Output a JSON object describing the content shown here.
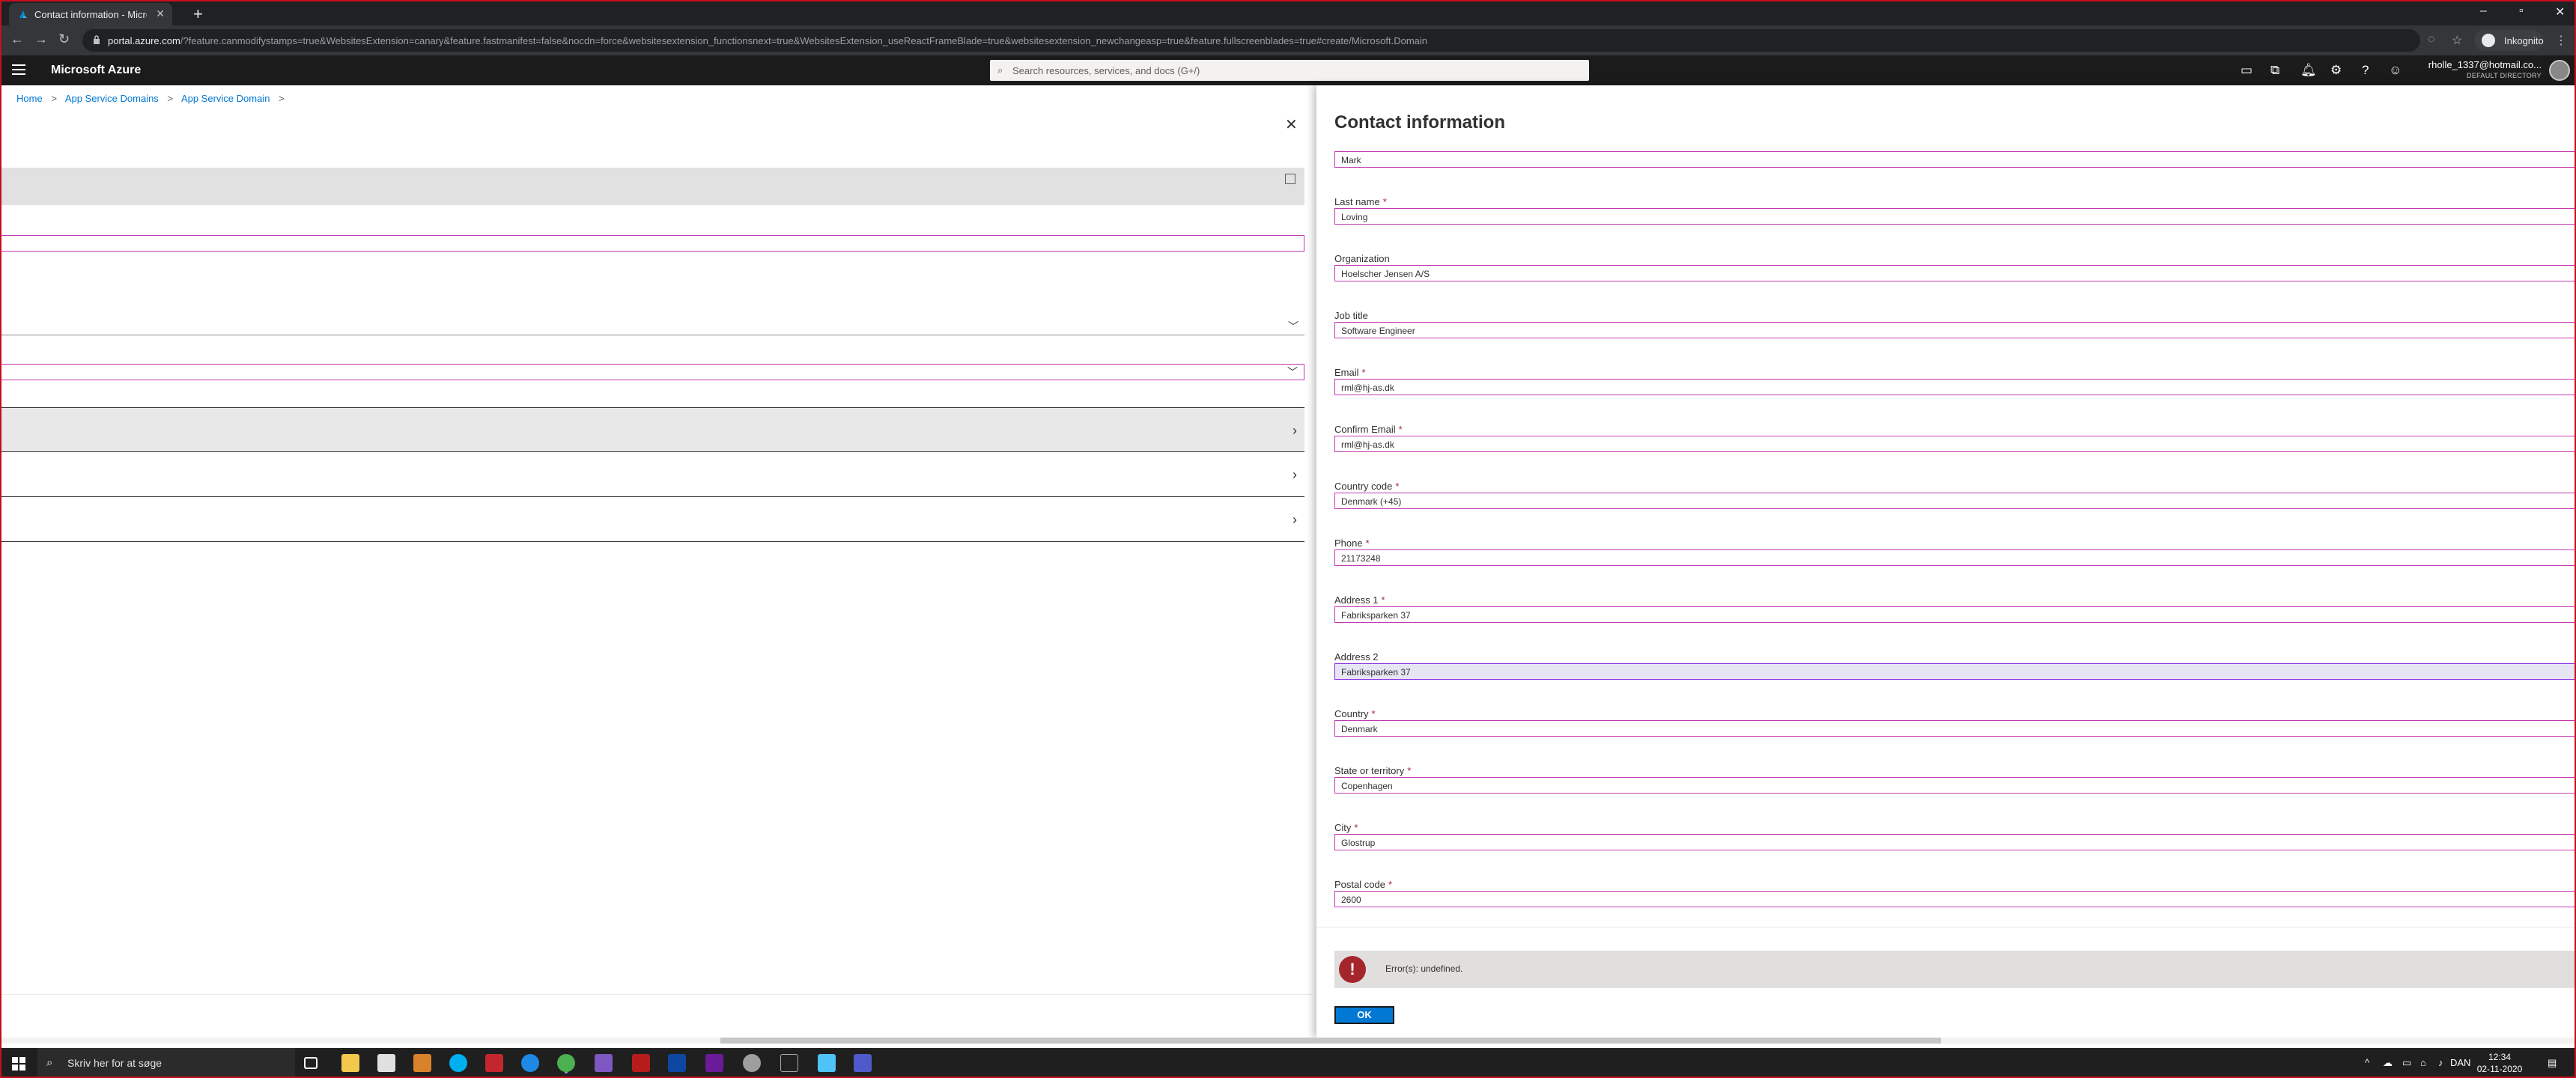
{
  "browser": {
    "tab_title": "Contact information - Microsoft Azure",
    "tab_close": "✕",
    "new_tab": "+",
    "url_host": "portal.azure.com",
    "url_rest": "/?feature.canmodifystamps=true&WebsitesExtension=canary&feature.fastmanifest=false&nocdn=force&websitesextension_functionsnext=true&WebsitesExtension_useReactFrameBlade=true&websitesextension_newchangeasp=true&feature.fullscreenblades=true#create/Microsoft.Domain",
    "incognito_label": "Inkognito",
    "icons": [
      "back-icon",
      "forward-icon",
      "reload-icon",
      "lock-icon",
      "eye-off-icon",
      "star-icon",
      "menu-icon"
    ]
  },
  "azure": {
    "brand": "Microsoft Azure",
    "search_placeholder": "Search resources, services, and docs (G+/)",
    "account_email": "rholle_1337@hotmail.co...",
    "account_directory": "DEFAULT DIRECTORY"
  },
  "breadcrumb": {
    "items": [
      "Home",
      "App Service Domains",
      "App Service Domain"
    ],
    "separator": ">"
  },
  "blade": {
    "title": "Contact information",
    "fields": [
      {
        "label": "",
        "value": "Mark",
        "required": false
      },
      {
        "label": "Last name",
        "value": "Loving",
        "required": true
      },
      {
        "label": "Organization",
        "value": "Hoelscher Jensen A/S",
        "required": false
      },
      {
        "label": "Job title",
        "value": "Software Engineer",
        "required": false
      },
      {
        "label": "Email",
        "value": "rml@hj-as.dk",
        "required": true
      },
      {
        "label": "Confirm Email",
        "value": "rml@hj-as.dk",
        "required": true
      },
      {
        "label": "Country code",
        "value": "Denmark (+45)",
        "required": true
      },
      {
        "label": "Phone",
        "value": "21173248",
        "required": true
      },
      {
        "label": "Address 1",
        "value": "Fabriksparken 37",
        "required": true
      },
      {
        "label": "Address 2",
        "value": "Fabriksparken 37",
        "required": false
      },
      {
        "label": "Country",
        "value": "Denmark",
        "required": true
      },
      {
        "label": "State or territory",
        "value": "Copenhagen",
        "required": true
      },
      {
        "label": "City",
        "value": "Glostrup",
        "required": true
      },
      {
        "label": "Postal code",
        "value": "2600",
        "required": true
      }
    ],
    "required_mark": "*",
    "error_text": "Error(s): undefined.",
    "ok_label": "OK"
  },
  "taskbar": {
    "search_placeholder": "Skriv her for at søge",
    "language": "DAN",
    "time": "12:34",
    "date": "02-11-2020"
  },
  "colors": {
    "azure_blue": "#0078d4",
    "required_red": "#a4262c",
    "input_border": "#c239b3",
    "error_bg": "#e1dfdd"
  }
}
